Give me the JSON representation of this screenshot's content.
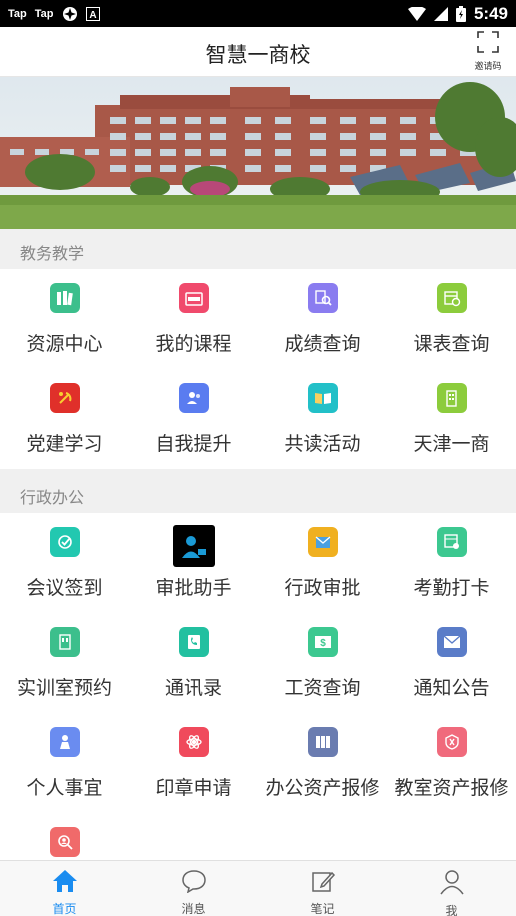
{
  "status_bar": {
    "left_labels": [
      "Tap",
      "Tap"
    ],
    "time": "5:49"
  },
  "header": {
    "title": "智慧一商校",
    "invite_label": "邀请码"
  },
  "sections": [
    {
      "title": "教务教学",
      "items": [
        {
          "label": "资源中心",
          "icon": "books-icon",
          "color": "#3cbf8c"
        },
        {
          "label": "我的课程",
          "icon": "course-icon",
          "color": "#f04a6c"
        },
        {
          "label": "成绩查询",
          "icon": "search-doc-icon",
          "color": "#8a7cf0"
        },
        {
          "label": "课表查询",
          "icon": "calendar-icon",
          "color": "#8ccc3c"
        },
        {
          "label": "党建学习",
          "icon": "party-icon",
          "color": "#e0302a"
        },
        {
          "label": "自我提升",
          "icon": "users-icon",
          "color": "#5a7cf0"
        },
        {
          "label": "共读活动",
          "icon": "book-open-icon",
          "color": "#22c0c8"
        },
        {
          "label": "天津一商",
          "icon": "building-icon",
          "color": "#8ccc3c"
        }
      ]
    },
    {
      "title": "行政办公",
      "items": [
        {
          "label": "会议签到",
          "icon": "checkin-icon",
          "color": "#22c8b0"
        },
        {
          "label": "审批助手",
          "icon": "approver-icon",
          "color": "#000000"
        },
        {
          "label": "行政审批",
          "icon": "mail-stack-icon",
          "color": "#f0b020"
        },
        {
          "label": "考勤打卡",
          "icon": "attendance-icon",
          "color": "#3cc890"
        },
        {
          "label": "实训室预约",
          "icon": "lab-icon",
          "color": "#3cbf8c"
        },
        {
          "label": "通讯录",
          "icon": "phone-book-icon",
          "color": "#22c0a0"
        },
        {
          "label": "工资查询",
          "icon": "salary-icon",
          "color": "#3cc890"
        },
        {
          "label": "通知公告",
          "icon": "notice-mail-icon",
          "color": "#5a7cc8"
        },
        {
          "label": "个人事宜",
          "icon": "person-icon",
          "color": "#6a8cf0"
        },
        {
          "label": "印章申请",
          "icon": "seal-icon",
          "color": "#f04a5c"
        },
        {
          "label": "办公资产报修",
          "icon": "office-asset-icon",
          "color": "#6a7cb0"
        },
        {
          "label": "教室资产报修",
          "icon": "classroom-asset-icon",
          "color": "#f06a7c"
        },
        {
          "label": "",
          "icon": "search-person-icon",
          "color": "#f06a6a"
        }
      ]
    }
  ],
  "tabs": [
    {
      "label": "首页",
      "icon": "home-icon",
      "active": true
    },
    {
      "label": "消息",
      "icon": "message-icon",
      "active": false
    },
    {
      "label": "笔记",
      "icon": "note-edit-icon",
      "active": false
    },
    {
      "label": "我",
      "icon": "user-icon",
      "active": false
    }
  ],
  "colors": {
    "accent": "#1a8cf0",
    "section_bg": "#f0f0f0"
  }
}
